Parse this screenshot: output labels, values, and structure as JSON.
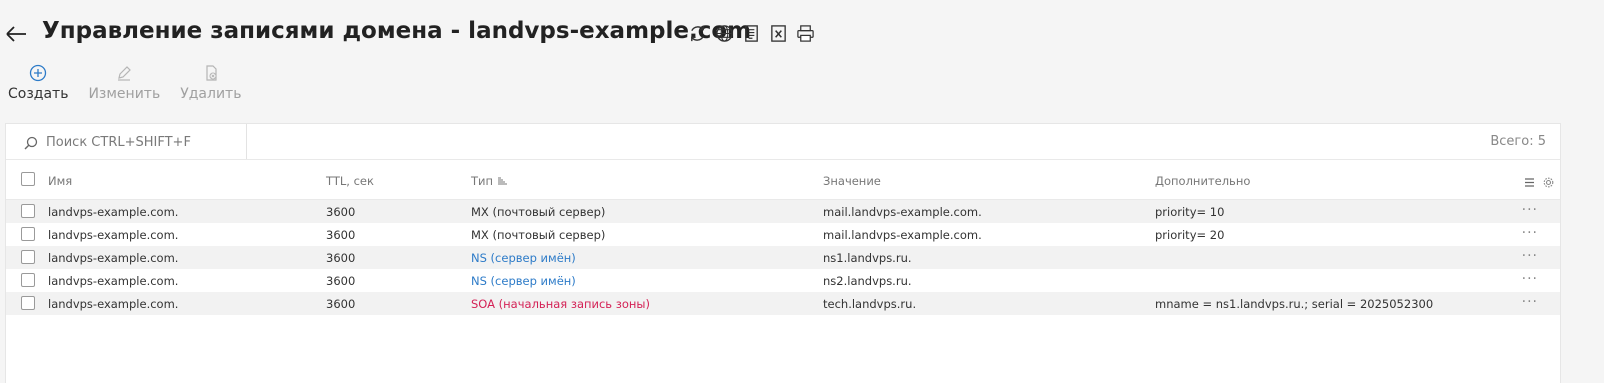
{
  "header": {
    "title": "Управление записями домена - landvps-example.com",
    "icons": [
      "back-arrow-icon",
      "refresh-icon",
      "globe-icon",
      "document-icon",
      "excel-icon",
      "print-icon"
    ]
  },
  "toolbar": {
    "create_label": "Создать",
    "edit_label": "Изменить",
    "delete_label": "Удалить"
  },
  "search": {
    "placeholder": "Поиск CTRL+SHIFT+F",
    "total": "Всего: 5"
  },
  "table": {
    "columns": {
      "name": "Имя",
      "ttl": "TTL, сек",
      "type": "Тип",
      "value": "Значение",
      "extra": "Дополнительно"
    },
    "rows": [
      {
        "name": "landvps-example.com.",
        "ttl": "3600",
        "type": "MX (почтовый сервер)",
        "value": "mail.landvps-example.com.",
        "extra": "priority= 10"
      },
      {
        "name": "landvps-example.com.",
        "ttl": "3600",
        "type": "MX (почтовый сервер)",
        "value": "mail.landvps-example.com.",
        "extra": "priority= 20"
      },
      {
        "name": "landvps-example.com.",
        "ttl": "3600",
        "type": "NS (сервер имён)",
        "value": "ns1.landvps.ru.",
        "extra": ""
      },
      {
        "name": "landvps-example.com.",
        "ttl": "3600",
        "type": "NS (сервер имён)",
        "value": "ns2.landvps.ru.",
        "extra": ""
      },
      {
        "name": "landvps-example.com.",
        "ttl": "3600",
        "type": "SOA (начальная запись зоны)",
        "value": "tech.landvps.ru.",
        "extra": "mname = ns1.landvps.ru.; serial = 2025052300"
      }
    ],
    "row_menu": "···"
  },
  "colors": {
    "accent": "#2d7bc8",
    "soa": "#d42256"
  }
}
